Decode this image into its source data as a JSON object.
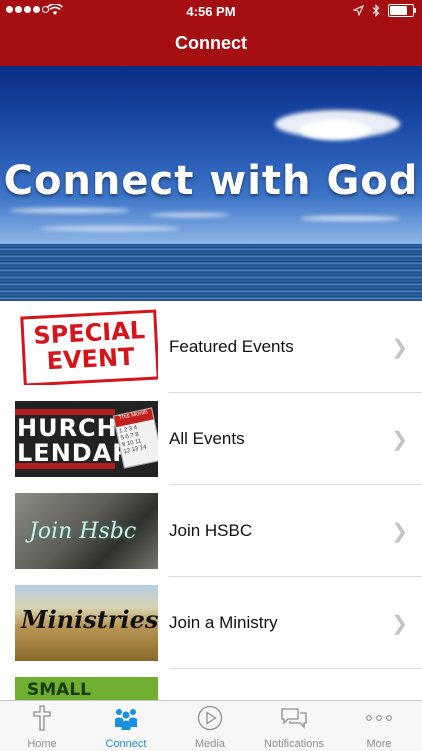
{
  "status_bar": {
    "time": "4:56 PM"
  },
  "header": {
    "title": "Connect"
  },
  "hero": {
    "text": "Connect with God"
  },
  "list": {
    "items": [
      {
        "label": "Featured Events",
        "thumb_text": [
          "SPECIAL",
          "EVENT"
        ]
      },
      {
        "label": "All Events",
        "thumb_text": [
          "HURCH",
          "LENDAR",
          "This Month"
        ]
      },
      {
        "label": "Join HSBC",
        "thumb_text": "Join Hsbc"
      },
      {
        "label": "Join a Ministry",
        "thumb_text": "Ministries"
      },
      {
        "label": "",
        "thumb_text": "SMALL"
      }
    ]
  },
  "tabbar": {
    "tabs": [
      {
        "label": "Home",
        "icon": "cross-icon"
      },
      {
        "label": "Connect",
        "icon": "people-icon",
        "active": true
      },
      {
        "label": "Media",
        "icon": "play-icon"
      },
      {
        "label": "Notifications",
        "icon": "speech-bubbles-icon"
      },
      {
        "label": "More",
        "icon": "more-dots-icon"
      }
    ]
  },
  "colors": {
    "header": "#a50f12",
    "accent": "#1a8fe0",
    "tab_inactive": "#8e8e93"
  }
}
